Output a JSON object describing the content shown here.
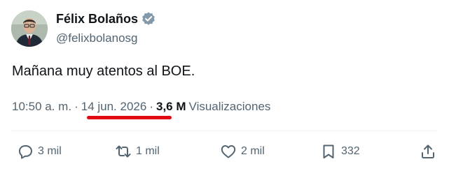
{
  "author": {
    "name": "Félix Bolaños",
    "handle": "@felixbolanosg",
    "verified_icon": "verified-badge-icon",
    "verified_color": "#829aab"
  },
  "tweet": {
    "text": "Mañana muy atentos al BOE."
  },
  "meta": {
    "time": "10:50 a. m.",
    "separator": "·",
    "date": "14 jun. 2026",
    "views_count": "3,6 M",
    "views_label": "Visualizaciones",
    "highlight_color": "#e30613"
  },
  "actions": {
    "reply": {
      "icon": "reply-bubble-icon",
      "count": "3 mil"
    },
    "repost": {
      "icon": "repost-icon",
      "count": "1 mil"
    },
    "like": {
      "icon": "heart-icon",
      "count": "2 mil"
    },
    "bookmark": {
      "icon": "bookmark-icon",
      "count": "332"
    },
    "share": {
      "icon": "share-icon"
    }
  },
  "colors": {
    "text_primary": "#0f1419",
    "text_secondary": "#536471",
    "divider": "#eff3f4"
  }
}
